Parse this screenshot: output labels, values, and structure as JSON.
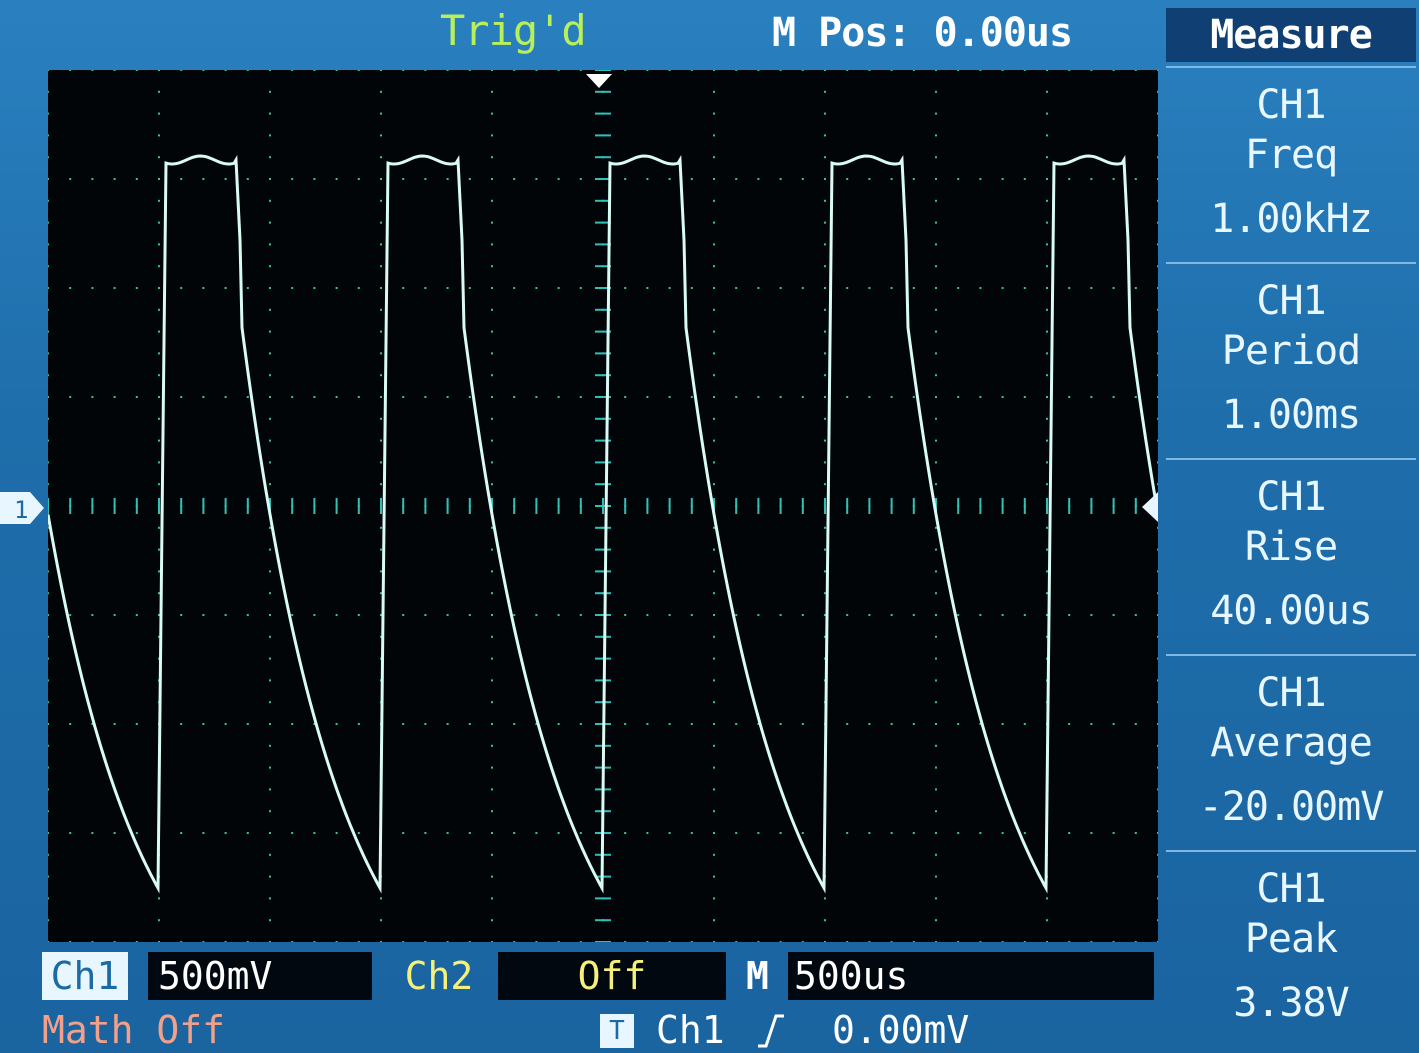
{
  "header": {
    "trigger_status": "Trig'd",
    "m_pos": "M Pos: 0.00us"
  },
  "channel_marker": "1",
  "menu": {
    "title": "Measure",
    "items": [
      {
        "channel": "CH1",
        "type": "Freq",
        "value": "1.00kHz"
      },
      {
        "channel": "CH1",
        "type": "Period",
        "value": "1.00ms"
      },
      {
        "channel": "CH1",
        "type": "Rise",
        "value": "40.00us"
      },
      {
        "channel": "CH1",
        "type": "Average",
        "value": "-20.00mV"
      },
      {
        "channel": "CH1",
        "type": "Peak",
        "value": "3.38V"
      }
    ]
  },
  "bottom": {
    "ch1_label": "Ch1",
    "ch1_scale": "500mV",
    "ch2_label": "Ch2",
    "ch2_scale": "Off",
    "m_label": "M",
    "m_scale": "500us",
    "math": "Math Off",
    "trigger_box": "T",
    "trigger_source": "Ch1",
    "trigger_level": "0.00mV"
  },
  "colors": {
    "trace": "#d8fbf6",
    "grid_dots": "#2fc0b8",
    "bezel": "#1f6fae"
  }
}
